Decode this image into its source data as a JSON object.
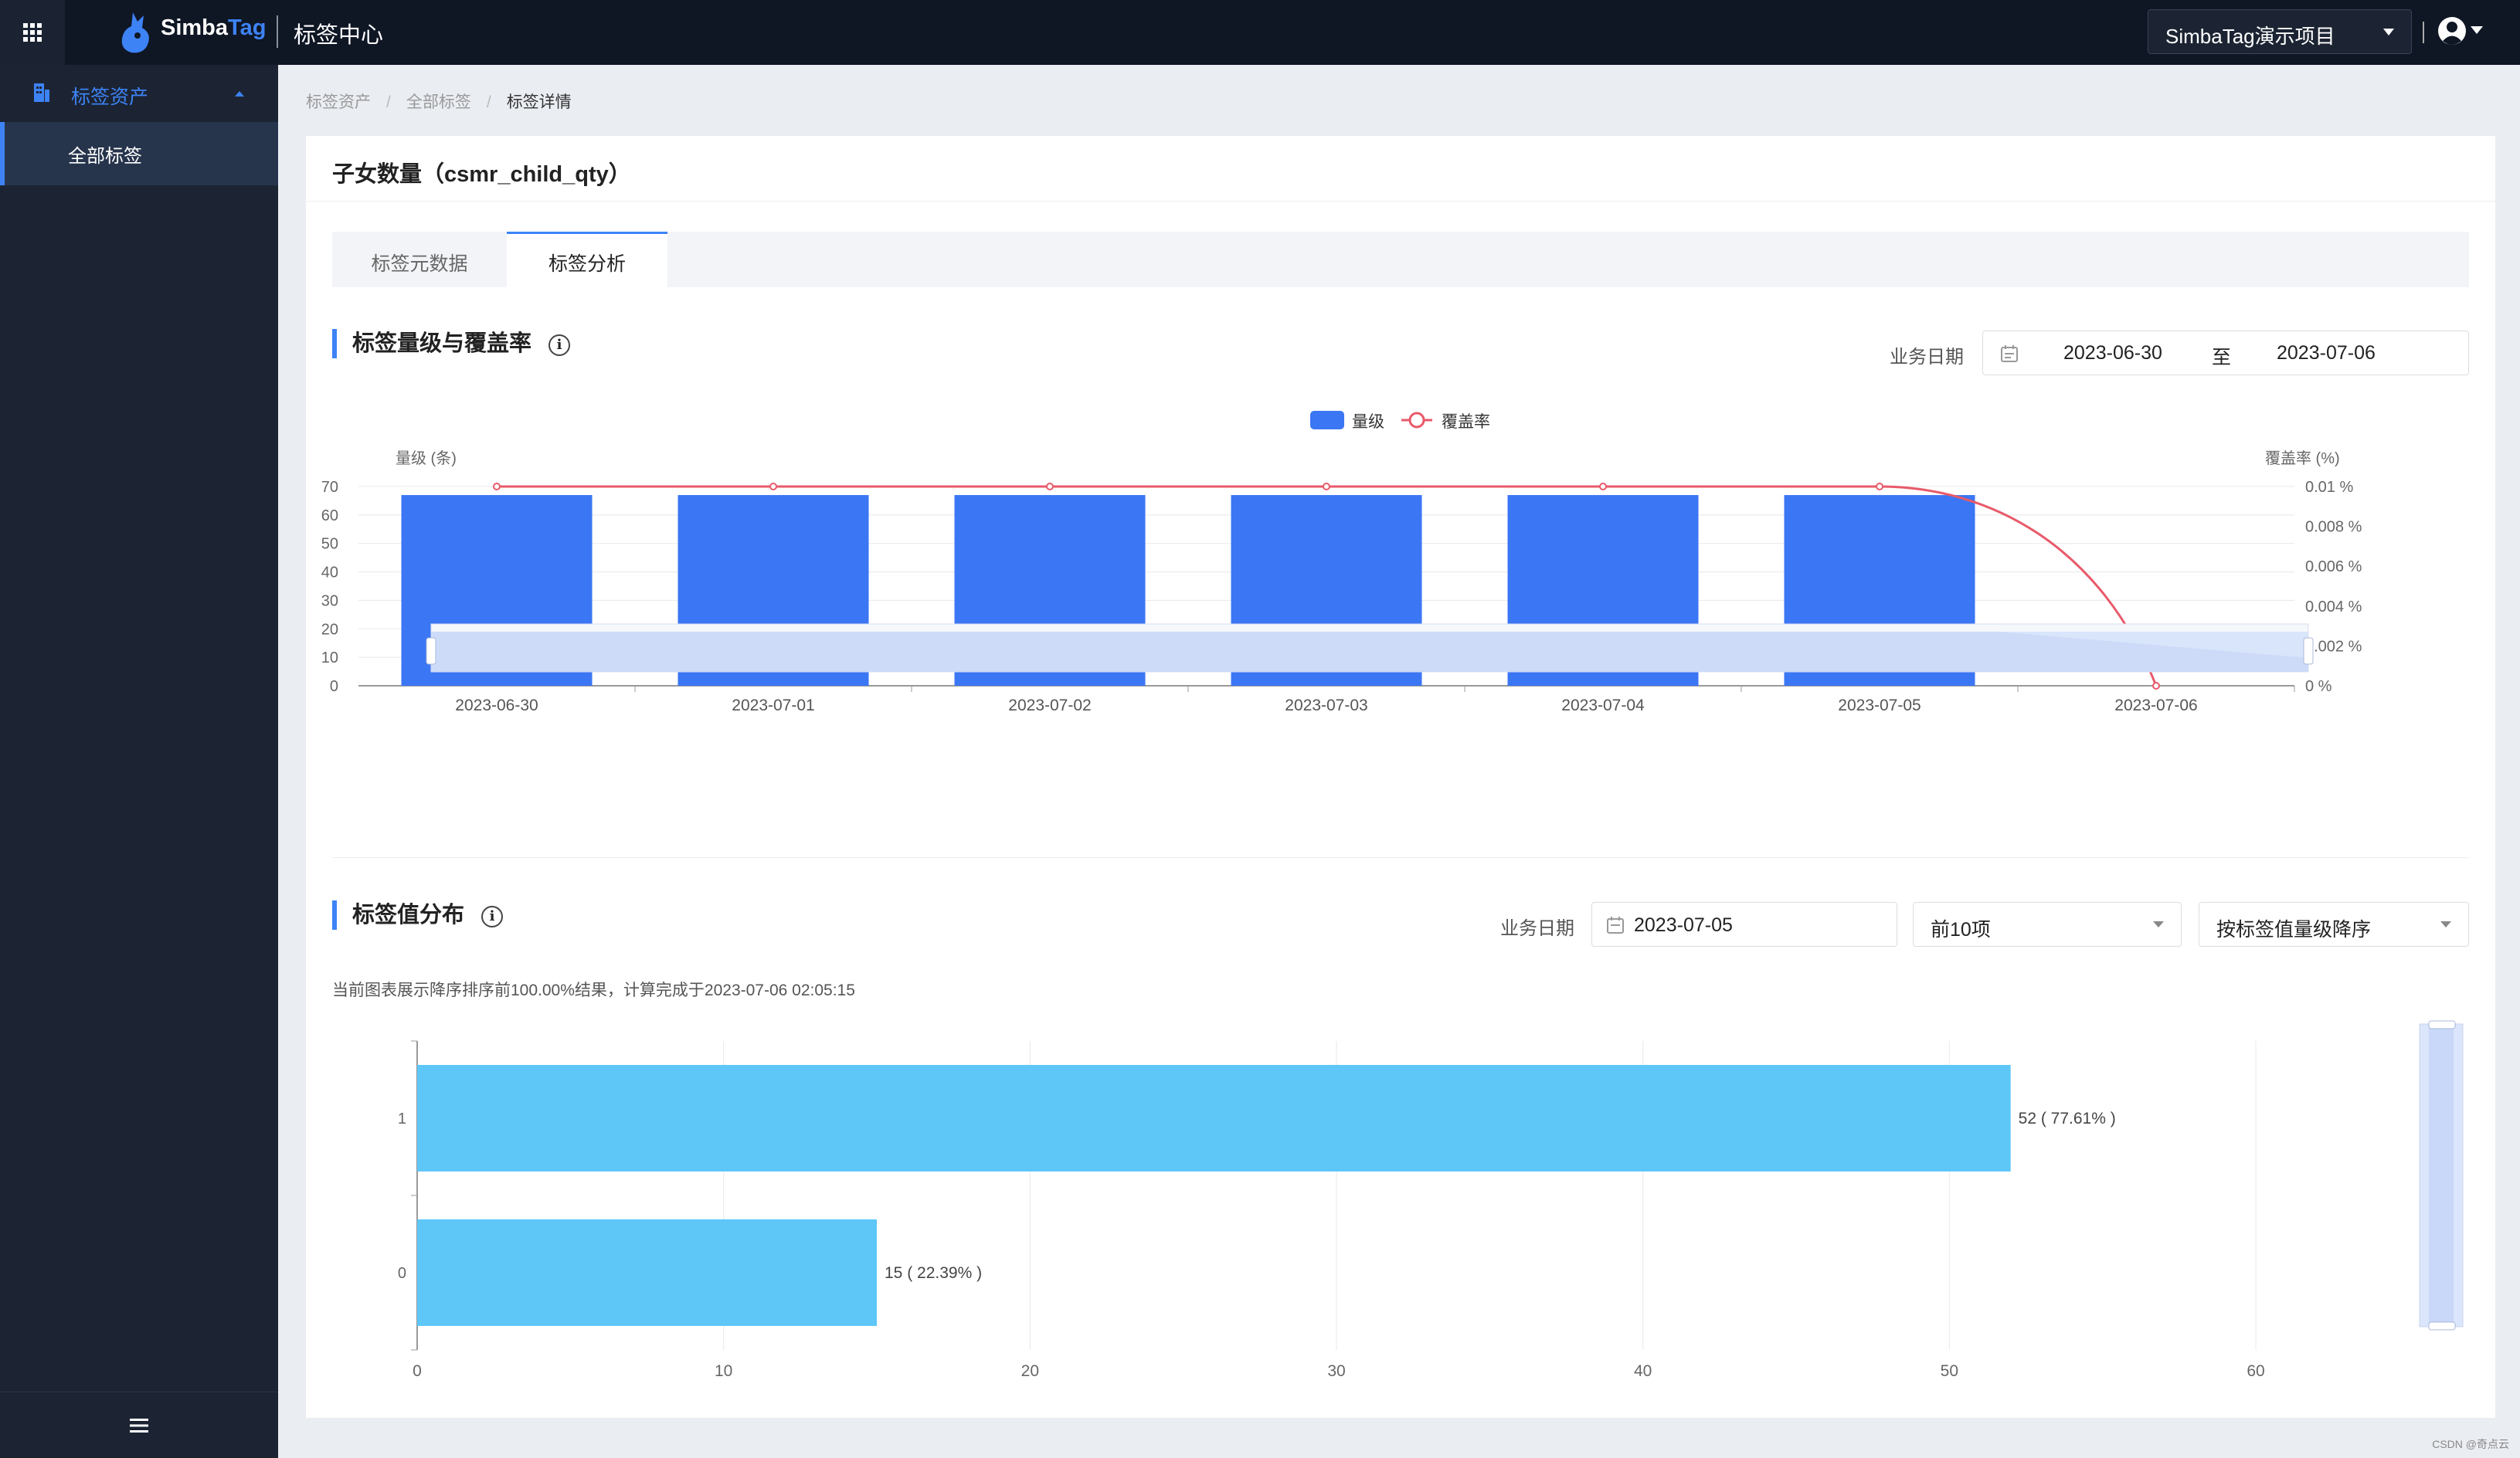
{
  "header": {
    "brand_simba": "Simba",
    "brand_tag": "Tag",
    "app_name": "标签中心",
    "project": "SimbaTag演示项目",
    "icons": [
      "grid-icon",
      "logo-icon",
      "chevron-down-icon",
      "user-avatar-icon"
    ]
  },
  "sidebar": {
    "group_label": "标签资产",
    "items": [
      {
        "label": "全部标签",
        "active": true
      }
    ],
    "menu_icon": "menu-icon"
  },
  "breadcrumb": [
    "标签资产",
    "全部标签",
    "标签详情"
  ],
  "page": {
    "title": "子女数量（csmr_child_qty）",
    "tabs": [
      {
        "label": "标签元数据",
        "active": false
      },
      {
        "label": "标签分析",
        "active": true
      }
    ]
  },
  "section1": {
    "title": "标签量级与覆盖率",
    "date_label": "业务日期",
    "date_start": "2023-06-30",
    "date_sep": "至",
    "date_end": "2023-07-06"
  },
  "section2": {
    "title": "标签值分布",
    "date_label": "业务日期",
    "date": "2023-07-05",
    "topn": "前10项",
    "sort": "按标签值量级降序",
    "note": "当前图表展示降序排序前100.00%结果，计算完成于2023-07-06 02:05:15"
  },
  "watermark": "CSDN @奇点云",
  "colors": {
    "accent": "#3d83f6",
    "bar": "#3b76f4",
    "line": "#e85a6a",
    "hbar": "#5ec7f8",
    "topbar": "#0f1624",
    "sidebar": "#1c2433"
  },
  "chart_data": [
    {
      "type": "bar",
      "legend": [
        "量级",
        "覆盖率"
      ],
      "legend_position": "top-center",
      "ylabel": "量级 (条)",
      "y2label": "覆盖率 (%)",
      "categories": [
        "2023-06-30",
        "2023-07-01",
        "2023-07-02",
        "2023-07-03",
        "2023-07-04",
        "2023-07-05",
        "2023-07-06"
      ],
      "y_ticks": [
        "0",
        "10",
        "20",
        "30",
        "40",
        "50",
        "60",
        "70"
      ],
      "y2_ticks": [
        "0 %",
        "0.002 %",
        "0.004 %",
        "0.006 %",
        "0.008 %",
        "0.01 %"
      ],
      "ylim": [
        0,
        70
      ],
      "y2lim": [
        0,
        0.01
      ],
      "series": [
        {
          "name": "量级",
          "type": "bar",
          "values": [
            67,
            67,
            67,
            67,
            67,
            67,
            0
          ]
        },
        {
          "name": "覆盖率",
          "type": "line",
          "values": [
            0.01,
            0.01,
            0.01,
            0.01,
            0.01,
            0.01,
            0
          ]
        }
      ],
      "grid": true
    },
    {
      "type": "bar",
      "orientation": "horizontal",
      "categories": [
        "1",
        "0"
      ],
      "values": [
        52,
        15
      ],
      "data_labels": [
        "52 ( 77.61% )",
        "15 ( 22.39% )"
      ],
      "x_ticks": [
        "0",
        "10",
        "20",
        "30",
        "40",
        "50",
        "60"
      ],
      "xlim": [
        0,
        60
      ],
      "grid": true
    }
  ]
}
